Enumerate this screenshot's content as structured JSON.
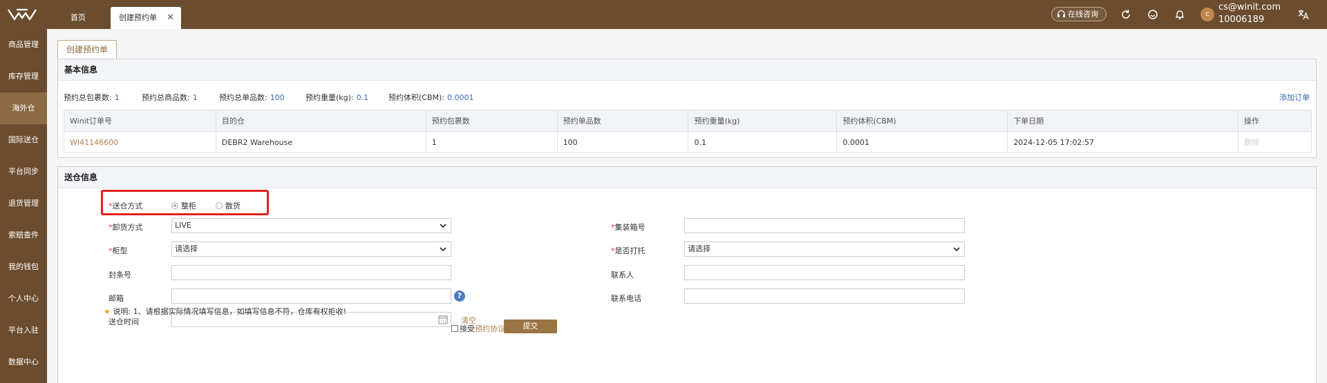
{
  "topbar": {
    "tabs": [
      {
        "label": "首页"
      },
      {
        "label": "创建预约单"
      }
    ],
    "close_glyph": "✕",
    "consult_label": "在线咨询",
    "icons": [
      "refresh-icon",
      "smile-icon",
      "bell-icon",
      "translate-icon"
    ],
    "user": {
      "avatar_letter": "c",
      "email": "cs@winit.com",
      "id": "10006189"
    }
  },
  "sidebar": {
    "items": [
      {
        "label": "商品管理"
      },
      {
        "label": "库存管理"
      },
      {
        "label": "海外仓"
      },
      {
        "label": "国际送仓"
      },
      {
        "label": "平台同步"
      },
      {
        "label": "退货管理"
      },
      {
        "label": "索赔查件"
      },
      {
        "label": "我的钱包"
      },
      {
        "label": "个人中心"
      },
      {
        "label": "平台入驻"
      },
      {
        "label": "数据中心"
      }
    ],
    "active_index": 2
  },
  "page_tab": "创建预约单",
  "basic": {
    "title": "基本信息",
    "stats": [
      {
        "label": "预约总包裹数:",
        "value": "1"
      },
      {
        "label": "预约总商品数:",
        "value": "1"
      },
      {
        "label": "预约总单品数:",
        "value": "100"
      },
      {
        "label": "预约重量(kg):",
        "value": "0.1"
      },
      {
        "label": "预约体积(CBM):",
        "value": "0.0001"
      }
    ],
    "add_order": "添加订单",
    "table": {
      "headers": [
        "Winit订单号",
        "目的仓",
        "预约包裹数",
        "预约单品数",
        "预约重量(kg)",
        "预约体积(CBM)",
        "下单日期",
        "操作"
      ],
      "rows": [
        [
          "WI41146600",
          "DEBR2 Warehouse",
          "1",
          "100",
          "0.1",
          "0.0001",
          "2024-12-05 17:02:57",
          "删除"
        ]
      ]
    }
  },
  "delivery": {
    "title": "送仓信息",
    "method_label": "送仓方式",
    "method_options": [
      "整柜",
      "散货"
    ],
    "method_selected": "整柜",
    "unload_label": "卸货方式",
    "unload_value": "LIVE",
    "cabinet_label": "柜型",
    "cabinet_value": "请选择",
    "seal_label": "封条号",
    "seal_value": "",
    "email_label": "邮箱",
    "email_value": "",
    "help_glyph": "?",
    "time_label": "送仓时间",
    "time_value": "",
    "clear_label": "清空",
    "container_label": "集装箱号",
    "container_value": "",
    "pallet_label": "是否打托",
    "pallet_value": "请选择",
    "contact_label": "联系人",
    "contact_value": "",
    "phone_label": "联系电话",
    "phone_value": "",
    "required_mark": "*",
    "note_prefix": "说明:",
    "note_text": "1、请根据实际情况填写信息，如填写信息不符，仓库有权拒收!",
    "accept_label": "接受",
    "agreement_link": "预约协议",
    "submit_label": "提交"
  },
  "colors": {
    "brand": "#6b4c2e",
    "accent": "#9b7443",
    "link": "#3a6ab1",
    "highlight": "#e02020"
  }
}
